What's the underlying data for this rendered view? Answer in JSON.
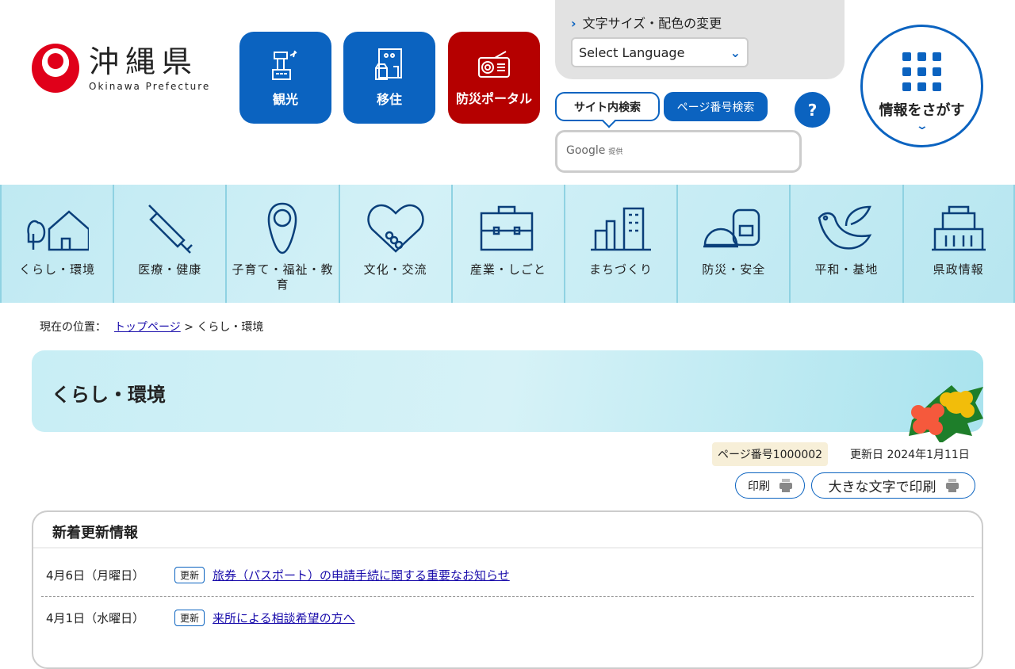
{
  "header": {
    "logo_ja": "沖縄県",
    "logo_en": "Okinawa Prefecture",
    "quick": [
      {
        "label": "観光",
        "icon": "airport-tower-icon"
      },
      {
        "label": "移住",
        "icon": "house-building-icon"
      },
      {
        "label": "防災ポータル",
        "icon": "radio-icon"
      }
    ],
    "font_color_link": "文字サイズ・配色の変更",
    "language_select": "Select Language",
    "search_tabs": [
      "サイト内検索",
      "ページ番号検索"
    ],
    "help": "?",
    "search_provider": "Google",
    "search_provider_suffix": "提供",
    "find_info": "情報をさがす"
  },
  "colors": {
    "primary": "#0b63c0",
    "disaster": "#b50000"
  },
  "gnav": [
    {
      "label": "くらし・環境"
    },
    {
      "label": "医療・健康"
    },
    {
      "label": "子育て・福祉・教育"
    },
    {
      "label": "文化・交流"
    },
    {
      "label": "産業・しごと"
    },
    {
      "label": "まちづくり"
    },
    {
      "label": "防災・安全"
    },
    {
      "label": "平和・基地"
    },
    {
      "label": "県政情報"
    }
  ],
  "breadcrumb": {
    "prefix": "現在の位置：",
    "home": "トップページ",
    "sep": ">",
    "current": "くらし・環境"
  },
  "page": {
    "title": "くらし・環境",
    "page_number": "ページ番号1000002",
    "updated": "更新日 2024年1月11日",
    "print": "印刷",
    "print_large": "大きな文字で印刷"
  },
  "news": {
    "title": "新着更新情報",
    "items": [
      {
        "date": "4月6日（月曜日）",
        "badge": "更新",
        "text": "旅券（パスポート）の申請手続に関する重要なお知らせ"
      },
      {
        "date": "4月1日（水曜日）",
        "badge": "更新",
        "text": "来所による相談希望の方へ"
      }
    ]
  }
}
